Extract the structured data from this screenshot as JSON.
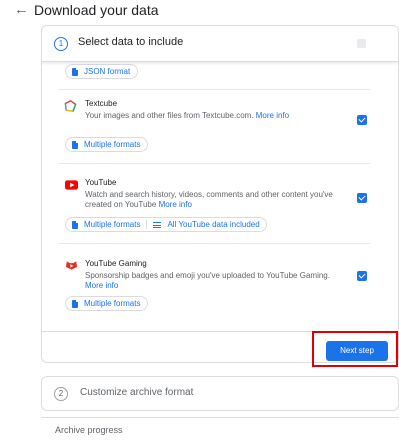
{
  "header": {
    "title": "Download your data",
    "back_icon": "back-arrow-icon"
  },
  "step1": {
    "number": "1",
    "title": "Select data to include",
    "json_format_label": "JSON format",
    "products": [
      {
        "name": "Textcube",
        "description": "Your images and other files from Textcube.com.",
        "more_info": "More info",
        "checked": true,
        "icon": "textcube-icon",
        "format_label": "Multiple formats"
      },
      {
        "name": "YouTube",
        "description": "Watch and search history, videos, comments and other content you've created on YouTube",
        "more_info": "More info",
        "checked": true,
        "icon": "youtube-icon",
        "format_label": "Multiple formats",
        "data_label": "All YouTube data included"
      },
      {
        "name": "YouTube Gaming",
        "description": "Sponsorship badges and emoji you've uploaded to YouTube Gaming.",
        "more_info": "More info",
        "checked": true,
        "icon": "youtube-gaming-icon",
        "format_label": "Multiple formats"
      }
    ],
    "next_label": "Next step"
  },
  "step2": {
    "number": "2",
    "title": "Customize archive format"
  },
  "progress": {
    "label": "Archive progress"
  },
  "colors": {
    "accent": "#1a73e8",
    "youtube_red": "#ff0000",
    "highlight": "#e00000"
  }
}
